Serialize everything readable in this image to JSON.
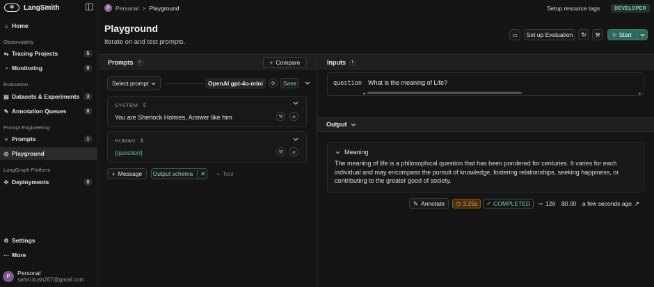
{
  "app": {
    "name": "LangSmith",
    "logo_glyph": "⦾"
  },
  "sidebar": {
    "home": "Home",
    "sections": [
      {
        "label": "Observability",
        "items": [
          {
            "label": "Tracing Projects",
            "count": "5",
            "icon": "trace-icon"
          },
          {
            "label": "Monitoring",
            "count": "0",
            "icon": "monitor-icon"
          }
        ]
      },
      {
        "label": "Evaluation",
        "items": [
          {
            "label": "Datasets & Experiments",
            "count": "3",
            "icon": "database-icon"
          },
          {
            "label": "Annotation Queues",
            "count": "0",
            "icon": "pencil-icon"
          }
        ]
      },
      {
        "label": "Prompt Engineering",
        "items": [
          {
            "label": "Prompts",
            "count": "1",
            "icon": "prompt-icon"
          },
          {
            "label": "Playground",
            "count": "",
            "icon": "playground-icon"
          }
        ]
      },
      {
        "label": "LangGraph Platform",
        "items": [
          {
            "label": "Deployments",
            "count": "0",
            "icon": "deploy-icon"
          }
        ]
      }
    ],
    "settings": "Settings",
    "more": "More",
    "user": {
      "name": "Personal",
      "email": "sahni.kush267@gmail.com",
      "initial": "P"
    }
  },
  "topbar": {
    "breadcrumb": {
      "workspace": "Personal",
      "separator": ">",
      "page": "Playground",
      "initial": "P"
    },
    "setup_tags": "Setup resource tags",
    "badge": "DEVELOPER"
  },
  "header": {
    "title": "Playground",
    "subtitle": "Iterate on and test prompts.",
    "setup_eval": "Set up Evaluation",
    "start": "Start"
  },
  "prompts_panel": {
    "title": "Prompts",
    "compare": "Compare",
    "select_prompt": "Select prompt",
    "model": "OpenAI gpt-4o-mini",
    "save": "Save",
    "messages": [
      {
        "role": "SYSTEM",
        "content": "You are Sherlock Holmes, Answer like him"
      },
      {
        "role": "HUMAN",
        "content": "{question}"
      }
    ],
    "add_message": "Message",
    "output_schema": "Output schema",
    "tool": "Tool"
  },
  "inputs_panel": {
    "title": "Inputs",
    "key": "question",
    "value": "What is the meaning of Life?"
  },
  "output_panel": {
    "title": "Output",
    "section": "Meaning",
    "text": "The meaning of life is a philosophical question that has been pondered for centuries. It varies for each individual and may encompass the pursuit of knowledge, fostering relationships, seeking happiness, or contributing to the greater good of society.",
    "annotate": "Annotate",
    "latency": "3.25s",
    "status": "COMPLETED",
    "tokens": "126",
    "cost": "$0.00",
    "time": "a few seconds ago"
  },
  "colors": {
    "accent": "#2d6a5c",
    "latency_bg": "#5a3a12",
    "latency_fg": "#f0a54a",
    "completed_fg": "#7fd1a6"
  }
}
